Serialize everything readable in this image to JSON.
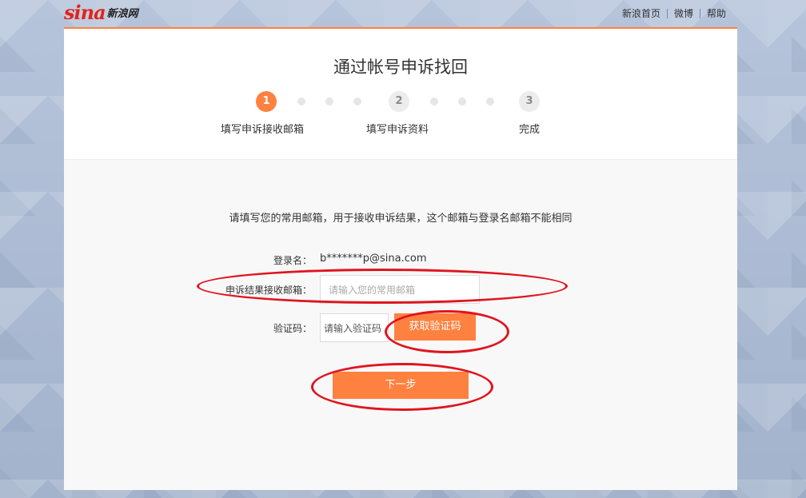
{
  "header": {
    "logo_text": "sina",
    "logo_cn": "新浪网",
    "links": [
      "新浪首页",
      "微博",
      "帮助"
    ]
  },
  "card": {
    "title": "通过帐号申诉找回",
    "steps": [
      {
        "number": "1",
        "label": "填写申诉接收邮箱",
        "state": "active"
      },
      {
        "number": "2",
        "label": "填写申诉资料",
        "state": "todo"
      },
      {
        "number": "3",
        "label": "完成",
        "state": "todo"
      }
    ],
    "notice": "请填写您的常用邮箱，用于接收申诉结果，这个邮箱与登录名邮箱不能相同",
    "form": {
      "login_label": "登录名：",
      "login_value": "b*******p@sina.com",
      "email_label": "申诉结果接收邮箱：",
      "email_placeholder": "请输入您的常用邮箱",
      "code_label": "验证码：",
      "code_placeholder": "请输入验证码",
      "get_code_button": "获取验证码",
      "next_button": "下一步"
    }
  },
  "colors": {
    "accent": "#ff8140",
    "annotation": "#e0141e"
  }
}
